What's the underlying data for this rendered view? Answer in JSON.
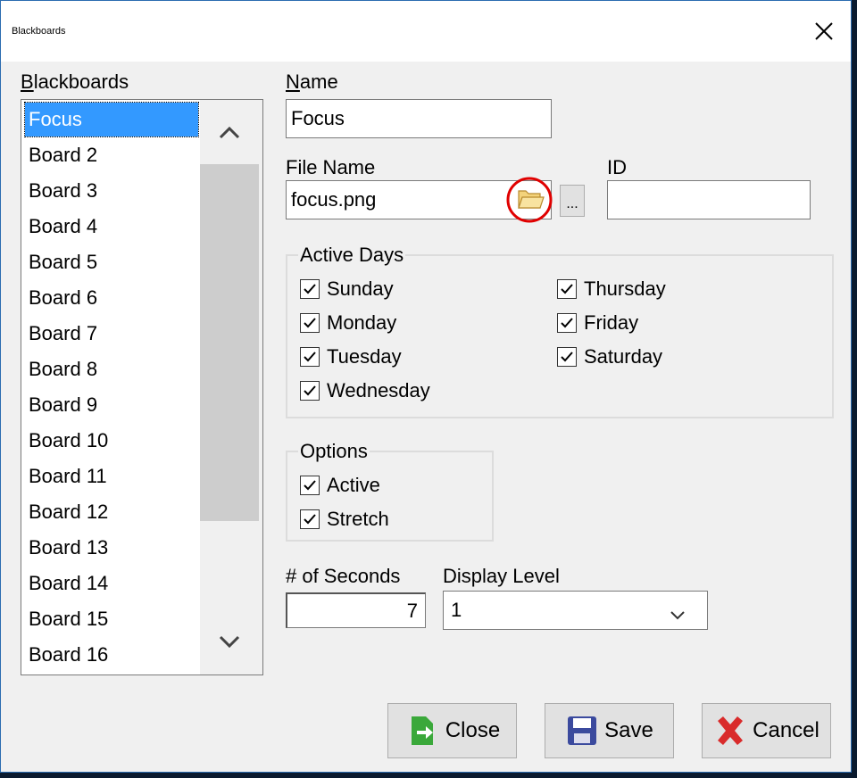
{
  "window": {
    "title": "Blackboards"
  },
  "blackboards": {
    "label": "Blackboards",
    "items": [
      "Focus",
      "Board 2",
      "Board 3",
      "Board 4",
      "Board 5",
      "Board 6",
      "Board 7",
      "Board 8",
      "Board 9",
      "Board 10",
      "Board 11",
      "Board 12",
      "Board 13",
      "Board 14",
      "Board 15",
      "Board 16"
    ],
    "selected": "Focus"
  },
  "name": {
    "label": "Name",
    "value": "Focus"
  },
  "file_name": {
    "label": "File Name",
    "value": "focus.png",
    "browse_label": "..."
  },
  "id": {
    "label": "ID",
    "value": ""
  },
  "active_days": {
    "title": "Active Days",
    "days": [
      {
        "label": "Sunday",
        "checked": true
      },
      {
        "label": "Monday",
        "checked": true
      },
      {
        "label": "Tuesday",
        "checked": true
      },
      {
        "label": "Wednesday",
        "checked": true
      },
      {
        "label": "Thursday",
        "checked": true
      },
      {
        "label": "Friday",
        "checked": true
      },
      {
        "label": "Saturday",
        "checked": true
      }
    ]
  },
  "options": {
    "title": "Options",
    "items": [
      {
        "label": "Active",
        "checked": true
      },
      {
        "label": "Stretch",
        "checked": true
      }
    ]
  },
  "seconds": {
    "label": "# of Seconds",
    "value": "7"
  },
  "display_level": {
    "label": "Display Level",
    "value": "1"
  },
  "buttons": {
    "close": "Close",
    "save": "Save",
    "cancel": "Cancel"
  },
  "colors": {
    "selection": "#3399ff",
    "highlight_circle": "#e00000",
    "cancel_icon": "#d92b2b",
    "close_icon": "#3aa83a",
    "save_icon": "#3b4a9e"
  },
  "icons": {
    "folder": "folder-icon",
    "close_window": "close-icon",
    "scroll_up": "chevron-up-icon",
    "scroll_down": "chevron-down-icon",
    "combo_arrow": "chevron-down-icon"
  }
}
